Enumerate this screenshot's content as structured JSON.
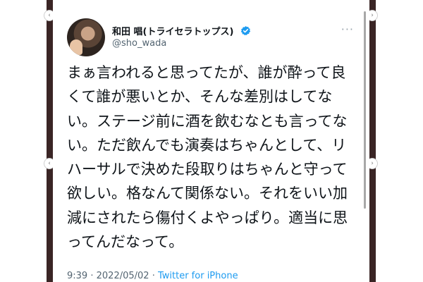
{
  "tweet": {
    "display_name": "和田 唱(トライセラトップス)",
    "handle": "@sho_wada",
    "more_label": "···",
    "text_lines": [
      "まぁ言われると思ってたが、誰が酔って良",
      "くて誰が悪いとか、そんな差別はしてな",
      "い。ステージ前に酒を飲むなとも言ってな",
      "い。ただ飲んでも演奏はちゃんとして、リ",
      "ハーサルで決めた段取りはちゃんと守って",
      "欲しい。格なんて関係ない。それをいい加",
      "減にされたら傷付くよやっぱり。適当に思",
      "ってんだなって。"
    ],
    "time": "9:39",
    "separator": "·",
    "date": "2022/05/02",
    "source": "Twitter for iPhone"
  },
  "colors": {
    "frame": "#3a2525",
    "verified": "#1d9bf0",
    "link": "#1d9bf0",
    "text": "#0f1419",
    "muted": "#536471"
  },
  "icons": {
    "verified": "verified-badge-icon",
    "more": "more-options-icon",
    "nav_left": "chevron-left-icon",
    "nav_right": "chevron-right-icon"
  }
}
